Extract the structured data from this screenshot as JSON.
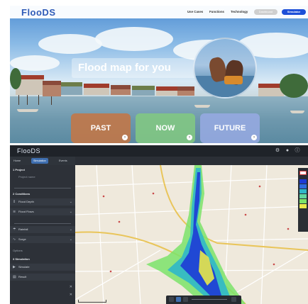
{
  "landing": {
    "logo": "FlooDS",
    "nav": {
      "links": [
        "Use Cases",
        "Functions",
        "Technology"
      ],
      "pill_1": "Dashboard",
      "simulator_button": "Simulator"
    },
    "hero_title": "Flood map for you",
    "buttons": {
      "past": "PAST",
      "now": "NOW",
      "future": "FUTURE"
    }
  },
  "app": {
    "logo": "FlooDS",
    "tabs": [
      "Home",
      "Simulation",
      "Events"
    ],
    "sidebar": {
      "project_header": "1 Project",
      "project_label": "Project name",
      "conditions_header": "2 Conditions",
      "flood_depth": "Flood Depth",
      "flood_flows": "Flood Flows",
      "rainfall": "Rainfall",
      "surge": "Surge",
      "options": "Options",
      "simulation_header": "3 Simulation",
      "simulate": "Simulate",
      "result": "Result"
    },
    "colors": {
      "accent": "#3f6fb0",
      "flood_deep": "#1e3bd6",
      "flood_mid": "#2fb7c9",
      "flood_shallow": "#7be36a"
    }
  }
}
